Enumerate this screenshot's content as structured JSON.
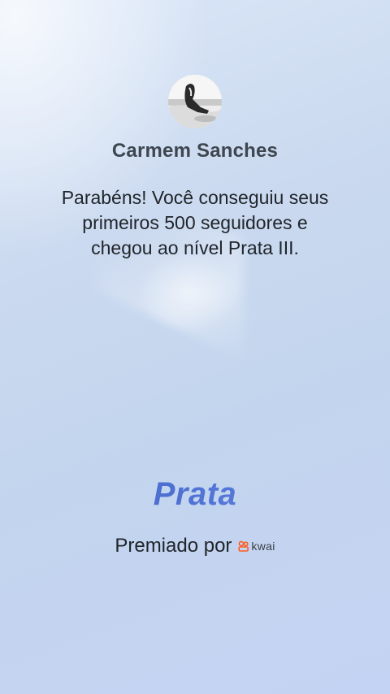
{
  "profile": {
    "name": "Carmem Sanches"
  },
  "message": {
    "line1": "Parabéns! Você conseguiu seus",
    "line2": "primeiros 500 seguidores e",
    "line3": "chegou ao nível Prata III."
  },
  "level": {
    "title": "Prata"
  },
  "awarded": {
    "label": "Premiado por",
    "brand": "kwai",
    "brand_color": "#ff5a1f"
  }
}
